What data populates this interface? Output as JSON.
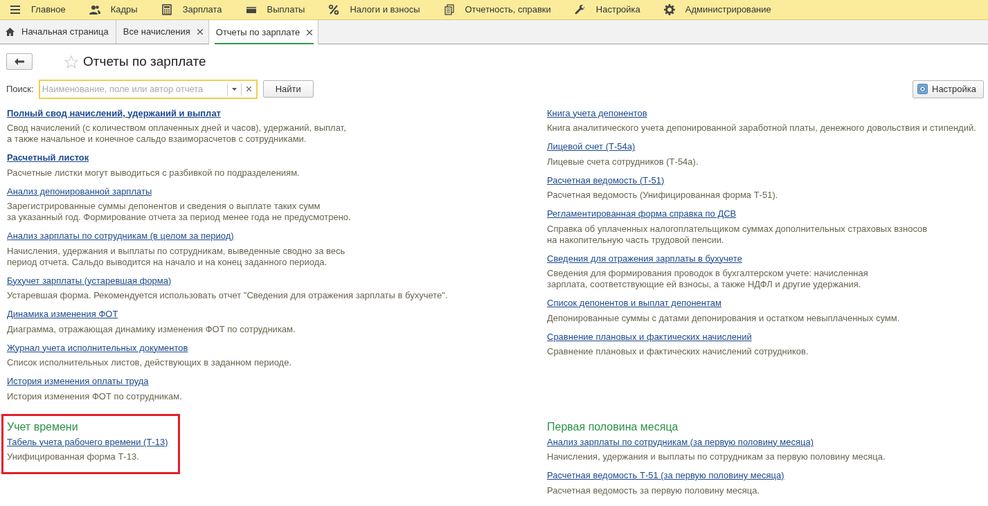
{
  "menu": [
    {
      "label": "Главное"
    },
    {
      "label": "Кадры"
    },
    {
      "label": "Зарплата"
    },
    {
      "label": "Выплаты"
    },
    {
      "label": "Налоги и взносы"
    },
    {
      "label": "Отчетность, справки"
    },
    {
      "label": "Настройка"
    },
    {
      "label": "Администрирование"
    }
  ],
  "tabs": [
    {
      "label": "Начальная страница",
      "kind": "home",
      "selected": false
    },
    {
      "label": "Все начисления",
      "kind": "closable",
      "selected": false
    },
    {
      "label": "Отчеты по зарплате",
      "kind": "closable",
      "selected": true
    }
  ],
  "title": "Отчеты по зарплате",
  "search": {
    "label": "Поиск:",
    "placeholder": "Наименование, поле или автор отчета",
    "find_button": "Найти",
    "settings_button": "Настройка"
  },
  "left_reports": [
    {
      "title": "Полный свод начислений, удержаний и выплат",
      "bold": true,
      "description": "Свод начислений (с количеством оплаченных дней и часов), удержаний, выплат,\nа также начальное и конечное сальдо взаиморасчетов с сотрудниками."
    },
    {
      "title": "Расчетный листок",
      "bold": true,
      "description": "Расчетные листки могут выводиться с разбивкой по подразделениям."
    },
    {
      "title": "Анализ депонированной зарплаты",
      "bold": false,
      "description": "Зарегистрированные суммы депонентов и сведения о выплате таких сумм\nза указанный год. Формирование отчета за период менее года не предусмотрено."
    },
    {
      "title": "Анализ зарплаты по сотрудникам (в целом за период)",
      "bold": false,
      "description": "Начисления, удержания и выплаты по сотрудникам, выведенные сводно за весь\nпериод отчета. Сальдо выводится на начало и на конец заданного периода."
    },
    {
      "title": "Бухучет зарплаты (устаревшая форма)",
      "bold": false,
      "description": "Устаревшая форма. Рекомендуется использовать отчет \"Сведения для отражения зарплаты в бухучете\"."
    },
    {
      "title": "Динамика изменения ФОТ",
      "bold": false,
      "description": "Диаграмма, отражающая динамику изменения ФОТ по сотрудникам."
    },
    {
      "title": "Журнал учета исполнительных документов",
      "bold": false,
      "description": "Список исполнительных листов, действующих в заданном периоде."
    },
    {
      "title": "История изменения оплаты труда",
      "bold": false,
      "description": "История изменения ФОТ по сотрудникам."
    }
  ],
  "right_reports": [
    {
      "title": "Книга учета депонентов",
      "bold": false,
      "description": "Книга аналитического учета депонированной заработной платы, денежного довольствия и стипендий."
    },
    {
      "title": "Лицевой счет (Т-54а)",
      "bold": false,
      "description": "Лицевые счета сотрудников (Т-54а)."
    },
    {
      "title": "Расчетная ведомость (Т-51)",
      "bold": false,
      "description": "Расчетная ведомость (Унифицированная форма Т-51)."
    },
    {
      "title": "Регламентированная форма справка по ДСВ",
      "bold": false,
      "description": "Справка об уплаченных налогоплательщиком суммах дополнительных страховых взносов\nна накопительную часть трудовой пенсии."
    },
    {
      "title": "Сведения для отражения зарплаты в бухучете",
      "bold": false,
      "description": "Сведения для формирования проводок в бухгалтерском учете: начисленная\nзарплата, соответствующие ей взносы, а также НДФЛ и другие удержания."
    },
    {
      "title": "Список депонентов и выплат депонентам",
      "bold": false,
      "description": "Депонированные суммы с датами депонирования и остатком невыплаченных сумм."
    },
    {
      "title": "Сравнение плановых и фактических начислений",
      "bold": false,
      "description": "Сравнение плановых и фактических начислений сотрудников."
    }
  ],
  "sections": [
    {
      "heading": "Учет времени",
      "highlighted": true,
      "reports": [
        {
          "title": "Табель учета рабочего времени (Т-13)",
          "bold": false,
          "description": "Унифицированная форма Т-13."
        }
      ]
    },
    {
      "heading": "Первая половина месяца",
      "highlighted": false,
      "reports": [
        {
          "title": "Анализ зарплаты по сотрудникам (за первую половину месяца)",
          "bold": false,
          "description": "Начисления, удержания и выплаты по сотрудникам за первую половину месяца."
        },
        {
          "title": "Расчетная ведомость Т-51 (за первую половину месяца)",
          "bold": false,
          "description": "Расчетная ведомость за первую половину месяца."
        }
      ]
    }
  ]
}
